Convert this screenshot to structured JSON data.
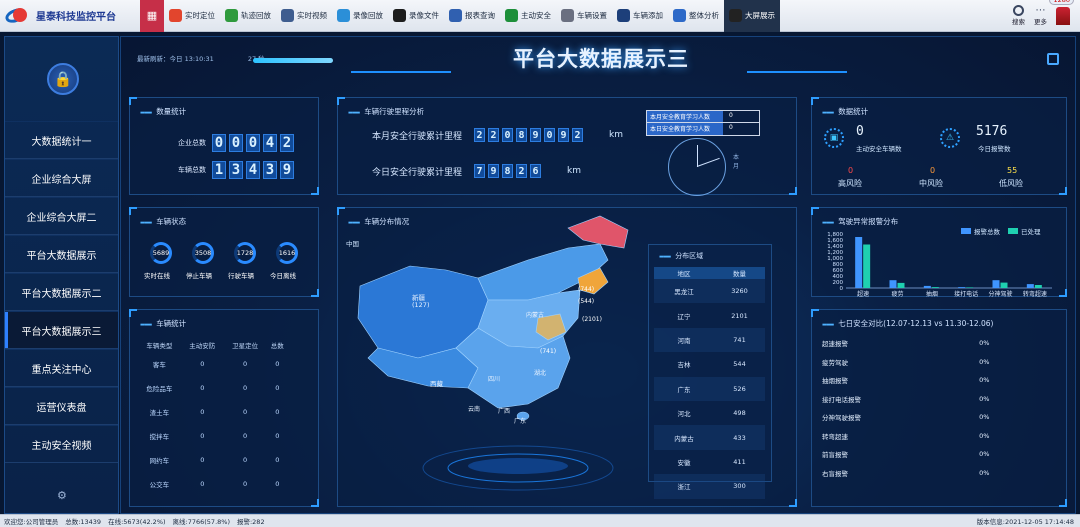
{
  "app": {
    "name": "星泰科技监控平台"
  },
  "nav": [
    {
      "label": "实时定位",
      "icon": "location-pin-icon",
      "color": "#e2452d"
    },
    {
      "label": "轨迹回放",
      "icon": "track-icon",
      "color": "#2f9a3d"
    },
    {
      "label": "实时视频",
      "icon": "video-camera-icon",
      "color": "#3f5d8f"
    },
    {
      "label": "录像回放",
      "icon": "playback-icon",
      "color": "#2b8fd8"
    },
    {
      "label": "录像文件",
      "icon": "clapper-icon",
      "color": "#1d1d1d"
    },
    {
      "label": "报表查询",
      "icon": "report-icon",
      "color": "#3060b0"
    },
    {
      "label": "主动安全",
      "icon": "shield-icon",
      "color": "#1d8f3a"
    },
    {
      "label": "车辆设置",
      "icon": "gear-icon",
      "color": "#6a6f80"
    },
    {
      "label": "车辆添加",
      "icon": "car-add-icon",
      "color": "#1d3f7a"
    },
    {
      "label": "整体分析",
      "icon": "bar-chart-icon",
      "color": "#2d69c8"
    },
    {
      "label": "大屏展示",
      "icon": "monitor-icon",
      "color": "#222"
    }
  ],
  "tools": {
    "search": "搜索",
    "more": "更多",
    "badge": "1280"
  },
  "sidebar": {
    "items": [
      "大数据统计一",
      "企业综合大屏",
      "企业综合大屏二",
      "平台大数据展示",
      "平台大数据展示二",
      "平台大数据展示三",
      "重点关注中心",
      "运营仪表盘",
      "主动安全视频"
    ],
    "active": 5
  },
  "header": {
    "refresh": "最新刷新：今日 13:10:31",
    "countdown": "27 秒",
    "title": "平台大数据展示三"
  },
  "stats": {
    "title": "数量统计",
    "company_label": "企业总数",
    "company_digits": [
      "0",
      "0",
      "0",
      "4",
      "2"
    ],
    "vehicle_label": "车辆总数",
    "vehicle_digits": [
      "1",
      "3",
      "4",
      "3",
      "9"
    ]
  },
  "mileage": {
    "title": "车辆行驶里程分析",
    "month_label": "本月安全行驶累计里程",
    "month_digits": [
      "2",
      "2",
      "0",
      "8",
      "9",
      "0",
      "9",
      "2"
    ],
    "today_label": "今日安全行驶累计里程",
    "today_digits": [
      "7",
      "9",
      "8",
      "2",
      "6"
    ],
    "unit": "km",
    "study_month_label": "本月安全教育学习人数",
    "study_month_value": "0",
    "study_today_label": "本日安全教育学习人数",
    "study_today_value": "0",
    "dial_label": "本月"
  },
  "safety": {
    "title": "数据统计",
    "active_vehicles_value": "0",
    "active_vehicles_label": "主动安全车辆数",
    "alarms_value": "5176",
    "alarms_label": "今日报警数",
    "high_value": "0",
    "high_label": "高风险",
    "mid_value": "0",
    "mid_label": "中风险",
    "low_value": "55",
    "low_label": "低风险"
  },
  "status": {
    "title": "车辆状态",
    "items": [
      {
        "value": "5689",
        "label": "实时在线"
      },
      {
        "value": "3508",
        "label": "停止车辆"
      },
      {
        "value": "1728",
        "label": "行驶车辆"
      },
      {
        "value": "1616",
        "label": "今日离线"
      }
    ]
  },
  "map": {
    "title": "车辆分布情况",
    "country": "中国",
    "labels": [
      "新疆",
      "西藏",
      "内蒙古",
      "四川",
      "湖北",
      "广东",
      "广西",
      "云南"
    ],
    "values": [
      "(127)",
      "(744)",
      "(544)",
      "(2101)",
      "(741)"
    ],
    "dist_title": "分布区域",
    "dist_headers": [
      "地区",
      "数量"
    ],
    "dist_rows": [
      [
        "黑龙江",
        "3260"
      ],
      [
        "辽宁",
        "2101"
      ],
      [
        "河南",
        "741"
      ],
      [
        "吉林",
        "544"
      ],
      [
        "广东",
        "526"
      ],
      [
        "河北",
        "498"
      ],
      [
        "内蒙古",
        "433"
      ],
      [
        "安徽",
        "411"
      ],
      [
        "浙江",
        "300"
      ]
    ]
  },
  "vstats": {
    "title": "车辆统计",
    "headers": [
      "车辆类型",
      "主动安防",
      "卫星定位",
      "总数"
    ],
    "rows": [
      [
        "客车",
        "0",
        "0",
        "0"
      ],
      [
        "危险品车",
        "0",
        "0",
        "0"
      ],
      [
        "渣土车",
        "0",
        "0",
        "0"
      ],
      [
        "搅拌车",
        "0",
        "0",
        "0"
      ],
      [
        "网约车",
        "0",
        "0",
        "0"
      ],
      [
        "公交车",
        "0",
        "0",
        "0"
      ]
    ]
  },
  "driving": {
    "title": "驾驶异常报警分布",
    "legend": [
      "报警总数",
      "已处理"
    ],
    "colors": [
      "#3f95ff",
      "#1fd0b0"
    ]
  },
  "chart_data": {
    "type": "bar",
    "categories": [
      "超速",
      "疲劳",
      "抽烟",
      "接打电话",
      "分神驾驶",
      "转弯超速"
    ],
    "series": [
      {
        "name": "报警总数",
        "values": [
          1700,
          260,
          70,
          30,
          260,
          130
        ]
      },
      {
        "name": "已处理",
        "values": [
          1450,
          170,
          30,
          20,
          180,
          100
        ]
      }
    ],
    "ylim": [
      0,
      1800
    ],
    "yticks": [
      "1,800",
      "1,600",
      "1,400",
      "1,200",
      "1,000",
      "800",
      "600",
      "400",
      "200",
      "0"
    ]
  },
  "weekly": {
    "title": "七日安全对比(12.07-12.13 vs 11.30-12.06)",
    "rows": [
      [
        "超速报警",
        "0%"
      ],
      [
        "疲劳驾驶",
        "0%"
      ],
      [
        "抽烟报警",
        "0%"
      ],
      [
        "接打电话报警",
        "0%"
      ],
      [
        "分神驾驶报警",
        "0%"
      ],
      [
        "转弯超速",
        "0%"
      ],
      [
        "前盲报警",
        "0%"
      ],
      [
        "右盲报警",
        "0%"
      ]
    ]
  },
  "footer": {
    "welcome": "欢迎您:公司管理员",
    "total": "总数:13439",
    "online": "在线:5673(42.2%)",
    "offline": "离线:7766(57.8%)",
    "alarm": "报警:282",
    "version": "版本信息:2021-12-05 17:14:48"
  }
}
